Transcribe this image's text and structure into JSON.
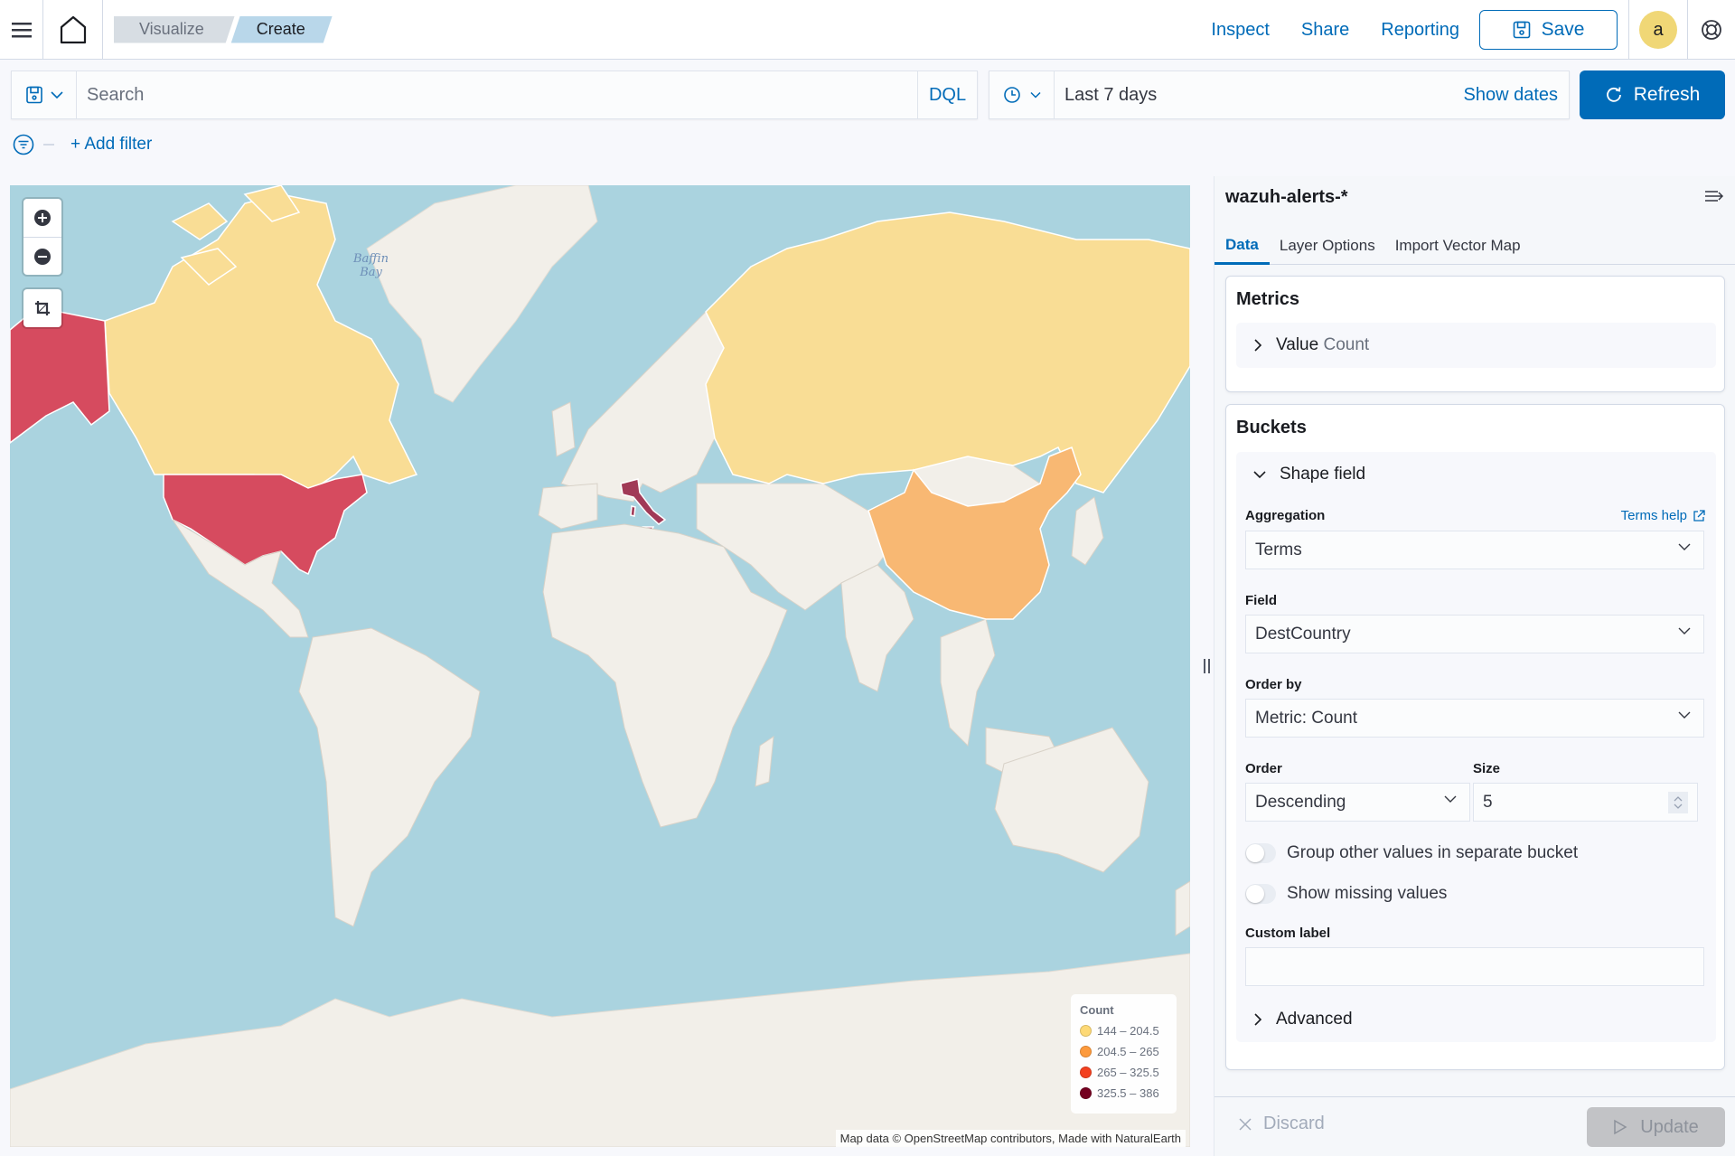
{
  "header": {
    "breadcrumbs": [
      "Visualize",
      "Create"
    ],
    "links": {
      "inspect": "Inspect",
      "share": "Share",
      "reporting": "Reporting"
    },
    "save_label": "Save",
    "avatar_initial": "a"
  },
  "query": {
    "search_placeholder": "Search",
    "search_value": "",
    "language": "DQL",
    "time_range": "Last 7 days",
    "show_dates": "Show dates",
    "refresh_label": "Refresh",
    "add_filter": "+ Add filter"
  },
  "map": {
    "water_label": [
      "Baffin",
      "Bay"
    ],
    "attribution": "Map data © OpenStreetMap contributors, Made with NaturalEarth",
    "legend": {
      "title": "Count",
      "buckets": [
        {
          "label": "144 – 204.5",
          "color": "#fdd976"
        },
        {
          "label": "204.5 – 265",
          "color": "#fd9a3c"
        },
        {
          "label": "265 – 325.5",
          "color": "#f3401f"
        },
        {
          "label": "325.5 – 386",
          "color": "#750020"
        }
      ]
    },
    "region_colors": {
      "bucket1": "#f9dd95",
      "bucket2": "#f8b873",
      "bucket3": "#d64b5f",
      "bucket4": "#a13a57",
      "land": "#f2efe9",
      "water": "#aad3df"
    },
    "countries": [
      {
        "name": "Italy",
        "bucket": "325.5 – 386"
      },
      {
        "name": "United States",
        "bucket": "265 – 325.5"
      },
      {
        "name": "China",
        "bucket": "204.5 – 265"
      },
      {
        "name": "Canada",
        "bucket": "144 – 204.5"
      },
      {
        "name": "Russia",
        "bucket": "144 – 204.5"
      }
    ]
  },
  "sidebar": {
    "index_pattern": "wazuh-alerts-*",
    "tabs": [
      {
        "label": "Data",
        "active": true
      },
      {
        "label": "Layer Options",
        "active": false
      },
      {
        "label": "Import Vector Map",
        "active": false
      }
    ],
    "metrics": {
      "title": "Metrics",
      "item_label": "Value",
      "item_desc": "Count"
    },
    "buckets": {
      "title": "Buckets",
      "item_label": "Shape field",
      "aggregation_label": "Aggregation",
      "aggregation_help": "Terms help",
      "aggregation_value": "Terms",
      "field_label": "Field",
      "field_value": "DestCountry",
      "order_by_label": "Order by",
      "order_by_value": "Metric: Count",
      "order_label": "Order",
      "order_value": "Descending",
      "size_label": "Size",
      "size_value": "5",
      "group_other_label": "Group other values in separate bucket",
      "group_other_on": false,
      "show_missing_label": "Show missing values",
      "show_missing_on": false,
      "custom_label_label": "Custom label",
      "custom_label_value": "",
      "advanced_label": "Advanced"
    },
    "discard_label": "Discard",
    "update_label": "Update"
  }
}
